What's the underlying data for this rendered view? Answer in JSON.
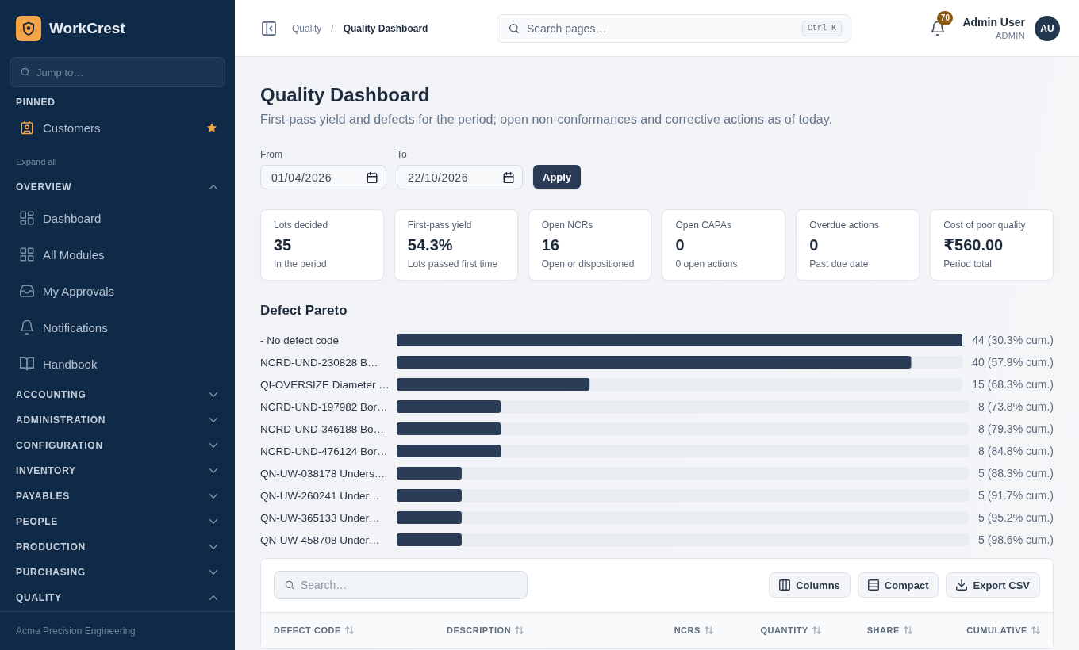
{
  "brand": {
    "name": "WorkCrest"
  },
  "sidebar": {
    "search": {
      "placeholder": "Jump to…"
    },
    "pinned": {
      "title": "PINNED",
      "items": [
        {
          "label": "Customers",
          "starred": true
        }
      ]
    },
    "expand_all": "Expand all",
    "sections": [
      {
        "title": "OVERVIEW",
        "expanded": true,
        "items": [
          {
            "label": "Dashboard"
          },
          {
            "label": "All Modules"
          },
          {
            "label": "My Approvals"
          },
          {
            "label": "Notifications"
          },
          {
            "label": "Handbook"
          }
        ]
      },
      {
        "title": "ACCOUNTING",
        "expanded": false
      },
      {
        "title": "ADMINISTRATION",
        "expanded": false
      },
      {
        "title": "CONFIGURATION",
        "expanded": false
      },
      {
        "title": "INVENTORY",
        "expanded": false
      },
      {
        "title": "PAYABLES",
        "expanded": false
      },
      {
        "title": "PEOPLE",
        "expanded": false
      },
      {
        "title": "PRODUCTION",
        "expanded": false
      },
      {
        "title": "PURCHASING",
        "expanded": false
      },
      {
        "title": "QUALITY",
        "expanded": true
      }
    ],
    "footer": "Acme Precision Engineering"
  },
  "header": {
    "breadcrumb": {
      "separator": "/",
      "items": [
        {
          "label": "Quality",
          "current": false
        },
        {
          "label": "Quality Dashboard",
          "current": true
        }
      ]
    },
    "search": {
      "placeholder": "Search pages…",
      "shortcut": "Ctrl K"
    },
    "notifications": {
      "count": "70"
    },
    "user": {
      "name": "Admin User",
      "role": "ADMIN",
      "initials": "AU"
    }
  },
  "page": {
    "title": "Quality Dashboard",
    "subtitle": "First-pass yield and defects for the period; open non-conformances and corrective actions as of today.",
    "filters": [
      {
        "label": "From",
        "value": "01/04/2026"
      },
      {
        "label": "To",
        "value": "22/10/2026"
      }
    ],
    "apply_button": "Apply"
  },
  "kpis": [
    {
      "label": "Lots decided",
      "value": "35",
      "note": "In the period"
    },
    {
      "label": "First-pass yield",
      "value": "54.3%",
      "note": "Lots passed first time"
    },
    {
      "label": "Open NCRs",
      "value": "16",
      "note": "Open or dispositioned"
    },
    {
      "label": "Open CAPAs",
      "value": "0",
      "note": "0 open actions"
    },
    {
      "label": "Overdue actions",
      "value": "0",
      "note": "Past due date"
    },
    {
      "label": "Cost of poor quality",
      "value": "₹560.00",
      "note": "Period total"
    }
  ],
  "pareto": {
    "chart_data": {
      "type": "bar",
      "orientation": "horizontal",
      "title": "Defect Pareto",
      "categories": [
        "- No defect code",
        "NCRD-UND-230828 B…",
        "QI-OVERSIZE Diameter …",
        "NCRD-UND-197982 Bor…",
        "NCRD-UND-346188 Bo…",
        "NCRD-UND-476124 Bor…",
        "QN-UW-038178 Unders…",
        "QN-UW-260241 Under…",
        "QN-UW-365133 Under…",
        "QN-UW-458708 Under…"
      ],
      "values": [
        44,
        40,
        15,
        8,
        8,
        8,
        5,
        5,
        5,
        5
      ],
      "value_labels": [
        "44 (30.3% cum.)",
        "40 (57.9% cum.)",
        "15 (68.3% cum.)",
        "8 (73.8% cum.)",
        "8 (79.3% cum.)",
        "8 (84.8% cum.)",
        "5 (88.3% cum.)",
        "5 (91.7% cum.)",
        "5 (95.2% cum.)",
        "5 (98.6% cum.)"
      ]
    }
  },
  "table": {
    "search": {
      "placeholder": "Search…"
    },
    "buttons": [
      {
        "label": "Columns"
      },
      {
        "label": "Compact"
      },
      {
        "label": "Export CSV"
      }
    ],
    "columns": [
      {
        "label": "DEFECT CODE",
        "kind": "text"
      },
      {
        "label": "DESCRIPTION",
        "kind": "text"
      },
      {
        "label": "NCRS",
        "kind": "number"
      },
      {
        "label": "QUANTITY",
        "kind": "number"
      },
      {
        "label": "SHARE",
        "kind": "number"
      },
      {
        "label": "CUMULATIVE",
        "kind": "number"
      }
    ]
  }
}
